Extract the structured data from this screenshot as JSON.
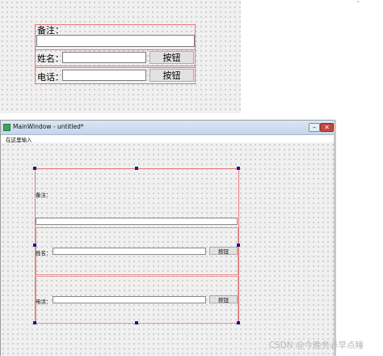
{
  "preview_form": {
    "remark_label": "备注：",
    "name_label": "姓名：",
    "phone_label": "电话：",
    "name_button": "按钮",
    "phone_button": "按钮"
  },
  "window": {
    "title": "MainWindow - untitled*",
    "menu_placeholder": "在这里输入",
    "minimize_symbol": "–",
    "maximize_symbol": "□",
    "close_symbol": "✕",
    "remark_label": "备注：",
    "name_label": "姓名：",
    "phone_label": "电话：",
    "name_button": "按钮",
    "phone_button": "按钮"
  },
  "top_marker": "\"",
  "watermark": "CSDN @今晚务必早点睡",
  "colors": {
    "layout_border": "#e2797b",
    "selection_handle": "#1a1a8c",
    "app_icon": "#3da35c",
    "close_button": "#c9463d"
  }
}
